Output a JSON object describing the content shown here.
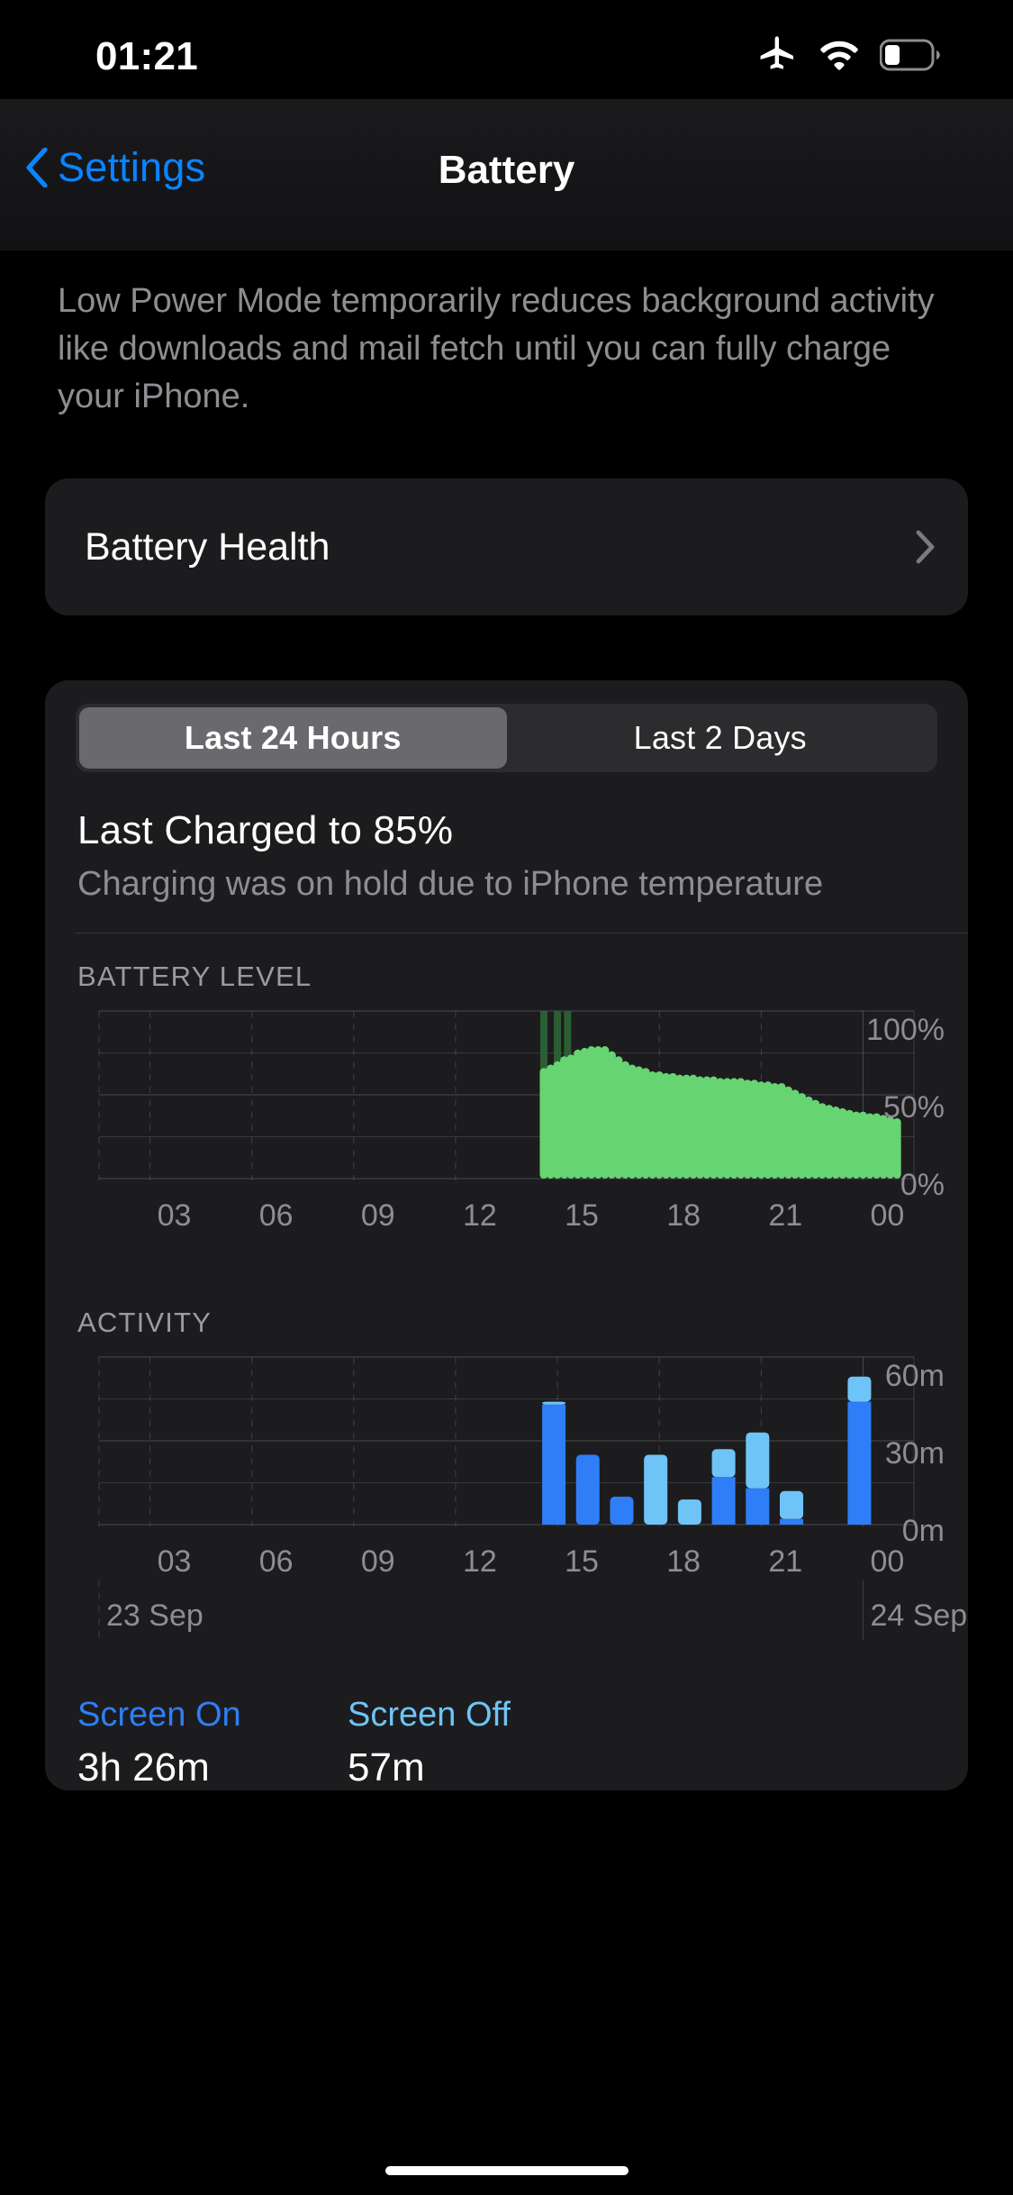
{
  "status_bar": {
    "time": "01:21",
    "icons": [
      "airplane-icon",
      "wifi-icon",
      "battery-icon"
    ],
    "battery_level_pct": 28
  },
  "nav": {
    "back_label": "Settings",
    "title": "Battery"
  },
  "low_power_footnote": "Low Power Mode temporarily reduces background activity like downloads and mail fetch until you can fully charge your iPhone.",
  "battery_health": {
    "label": "Battery Health",
    "disclosure": "chevron-right-icon"
  },
  "usage": {
    "segments": [
      {
        "label": "Last 24 Hours",
        "selected": true
      },
      {
        "label": "Last 2 Days",
        "selected": false
      }
    ],
    "last_charged_title": "Last Charged to 85%",
    "last_charged_subtitle": "Charging was on hold due to iPhone temperature",
    "battery_level_heading": "BATTERY LEVEL",
    "activity_heading": "ACTIVITY",
    "date_start": "23 Sep",
    "date_end": "24 Sep",
    "screen_on_label": "Screen On",
    "screen_on_value": "3h 26m",
    "screen_off_label": "Screen Off",
    "screen_off_value": "57m"
  },
  "colors": {
    "accent_blue": "#0A84FF",
    "battery_green": "#67D472",
    "charging_green": "#2c5e33",
    "screen_on_blue": "#2F7EF7",
    "screen_off_blue": "#6FC4F7",
    "card_bg": "#1C1C1E",
    "grid": "#5a5a5e"
  },
  "chart_data": [
    {
      "type": "bar",
      "title": "BATTERY LEVEL",
      "ylabel": "",
      "xlabel": "",
      "ylim": [
        0,
        100
      ],
      "ytick_labels": [
        "100%",
        "50%",
        "0%"
      ],
      "ytick_values": [
        100,
        50,
        0
      ],
      "xtick_labels": [
        "03",
        "06",
        "09",
        "12",
        "15",
        "18",
        "21",
        "00"
      ],
      "xtick_values": [
        3,
        6,
        9,
        12,
        15,
        18,
        21,
        24
      ],
      "xlim": [
        1.5,
        25.5
      ],
      "grid": true,
      "bar_color": "#67D472",
      "charging_color": "#2c5e33",
      "note": "Hourly battery level; dark-green ticks mark charging intervals near 14:30-15:30",
      "series": [
        {
          "name": "Battery level",
          "x": [
            14.6,
            14.8,
            15.0,
            15.2,
            15.4,
            15.6,
            15.8,
            16.0,
            16.2,
            16.4,
            16.6,
            16.8,
            17.0,
            17.2,
            17.4,
            17.6,
            17.8,
            18.0,
            18.2,
            18.4,
            18.6,
            18.8,
            19.0,
            19.2,
            19.4,
            19.6,
            19.8,
            20.0,
            20.2,
            20.4,
            20.6,
            20.8,
            21.0,
            21.2,
            21.4,
            21.6,
            21.8,
            22.0,
            22.2,
            22.4,
            22.6,
            22.8,
            23.0,
            23.2,
            23.4,
            23.6,
            23.8,
            24.0,
            24.2,
            24.4,
            24.6,
            24.8,
            25.0
          ],
          "values": [
            66,
            68,
            70,
            73,
            74,
            77,
            78,
            79,
            79,
            79,
            76,
            73,
            70,
            68,
            67,
            66,
            64,
            64,
            63,
            63,
            62,
            62,
            62,
            61,
            61,
            61,
            60,
            60,
            60,
            60,
            59,
            59,
            58,
            58,
            57,
            57,
            55,
            53,
            51,
            49,
            47,
            45,
            44,
            43,
            42,
            41,
            40,
            40,
            39,
            39,
            38,
            37,
            36
          ]
        },
        {
          "name": "Charging",
          "x": [
            14.6,
            15.0,
            15.3
          ],
          "values": [
            100,
            100,
            100
          ]
        }
      ]
    },
    {
      "type": "bar",
      "title": "ACTIVITY",
      "ylabel": "",
      "xlabel": "",
      "ylim": [
        0,
        60
      ],
      "ytick_labels": [
        "60m",
        "30m",
        "0m"
      ],
      "ytick_values": [
        60,
        30,
        0
      ],
      "xtick_labels": [
        "03",
        "06",
        "09",
        "12",
        "15",
        "18",
        "21",
        "00"
      ],
      "xtick_values": [
        3,
        6,
        9,
        12,
        15,
        18,
        21,
        24
      ],
      "xlim": [
        1.5,
        25.5
      ],
      "grid": true,
      "stacked": true,
      "bar_unit": "minutes",
      "categories": [
        15,
        16,
        17,
        18,
        19,
        20,
        21,
        22,
        23,
        24
      ],
      "series": [
        {
          "name": "Screen On",
          "color": "#2F7EF7",
          "values": [
            43,
            25,
            10,
            0,
            0,
            17,
            13,
            2,
            0,
            44
          ]
        },
        {
          "name": "Screen Off",
          "color": "#6FC4F7",
          "values": [
            1,
            0,
            0,
            25,
            9,
            10,
            20,
            10,
            0,
            9
          ]
        }
      ],
      "totals_minutes": [
        44,
        25,
        10,
        25,
        9,
        27,
        33,
        12,
        0,
        53
      ],
      "screen_on_total": "3h 26m",
      "screen_off_total": "57m"
    }
  ]
}
